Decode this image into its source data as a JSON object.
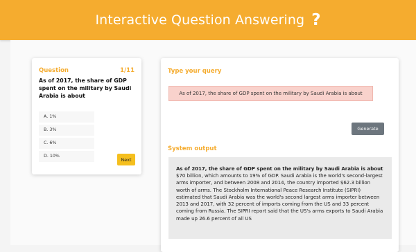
{
  "header": {
    "title": "Interactive Question Answering",
    "icon": "help-icon"
  },
  "question": {
    "label": "Question",
    "progress": "1/11",
    "text": "As of 2017, the share of GDP spent on the military by Saudi Arabia is about",
    "options": [
      "A. 1%",
      "B. 3%",
      "C. 6%",
      "D. 10%"
    ],
    "next_label": "Next"
  },
  "query": {
    "title": "Type your query",
    "value": "As of 2017, the share of GDP spent on the military by Saudi Arabia is about",
    "generate_label": "Generate"
  },
  "output": {
    "title": "System output",
    "bold_prefix": "As of 2017, the share of GDP spent on the military by Saudi Arabia is about",
    "text": " $70 billion, which amounts to 19% of GDP. Saudi Arabia is the world's second-largest arms importer, and between 2008 and 2014, the country imported $62.3 billion worth of arms. The Stockholm International Peace Research Institute (SIPRI) estimated that Saudi Arabia was the world's second largest arms importer between 2013 and 2017, with 32 percent of imports coming from the US and 33 percent coming from Russia. The SIPRI report said that the US's arms exports to Saudi Arabia made up 26.6 percent of all US"
  },
  "colors": {
    "accent": "#f5ac2f",
    "next_button": "#f5bf1e",
    "query_bg": "#f9d2cc",
    "generate_button": "#6d767e"
  }
}
